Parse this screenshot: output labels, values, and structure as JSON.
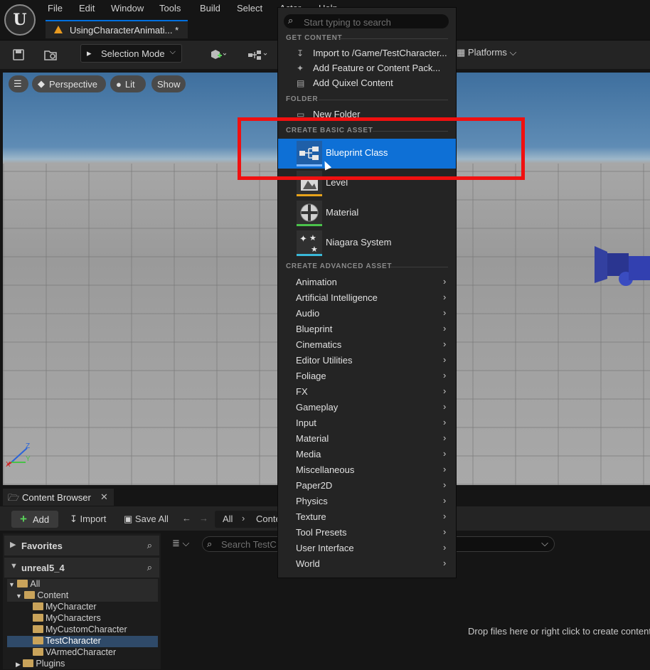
{
  "window": {
    "logo_letter": "U",
    "menus": [
      "File",
      "Edit",
      "Window",
      "Tools",
      "Build",
      "Select",
      "Actor",
      "Help"
    ],
    "doc_tab": "UsingCharacterAnimati... *"
  },
  "toolbar": {
    "selection_mode": "Selection Mode",
    "platforms": "Platforms"
  },
  "viewport": {
    "menu_icon": "hamburger-icon",
    "perspective": "Perspective",
    "lit": "Lit",
    "show": "Show"
  },
  "dropdown": {
    "search_placeholder": "Start typing to search",
    "get_content": {
      "header": "GET CONTENT",
      "items": [
        {
          "label": "Import to /Game/TestCharacter...",
          "icon": "import-icon"
        },
        {
          "label": "Add Feature or Content Pack...",
          "icon": "feature-pack-icon"
        },
        {
          "label": "Add Quixel Content",
          "icon": "quixel-icon"
        }
      ]
    },
    "folder": {
      "header": "FOLDER",
      "items": [
        {
          "label": "New Folder",
          "icon": "new-folder-icon"
        }
      ]
    },
    "basic": {
      "header": "CREATE BASIC ASSET",
      "items": [
        {
          "label": "Blueprint Class",
          "bar_color": "#2a7bd6",
          "selected": true
        },
        {
          "label": "Level",
          "bar_color": "#e8a21a"
        },
        {
          "label": "Material",
          "bar_color": "#4bc24b"
        },
        {
          "label": "Niagara System",
          "bar_color": "#3ab8d8"
        }
      ]
    },
    "advanced": {
      "header": "CREATE ADVANCED ASSET",
      "categories": [
        "Animation",
        "Artificial Intelligence",
        "Audio",
        "Blueprint",
        "Cinematics",
        "Editor Utilities",
        "Foliage",
        "FX",
        "Gameplay",
        "Input",
        "Material",
        "Media",
        "Miscellaneous",
        "Paper2D",
        "Physics",
        "Texture",
        "Tool Presets",
        "User Interface",
        "World"
      ]
    }
  },
  "content_browser": {
    "tab": "Content Browser",
    "add": "Add",
    "import": "Import",
    "save_all": "Save All",
    "path_all": "All",
    "path_content": "Conte",
    "favorites": "Favorites",
    "project": "unreal5_4",
    "tree": {
      "all": "All",
      "content": "Content",
      "folders": [
        "MyCharacter",
        "MyCharacters",
        "MyCustomCharacter",
        "TestCharacter",
        "VArmedCharacter"
      ],
      "selected_folder": "TestCharacter",
      "plugins": "Plugins"
    },
    "search_placeholder": "Search TestC",
    "drop_hint": "Drop files here or right click to create content"
  },
  "colors": {
    "accent": "#0e70d6",
    "highlight": "#f01010"
  }
}
